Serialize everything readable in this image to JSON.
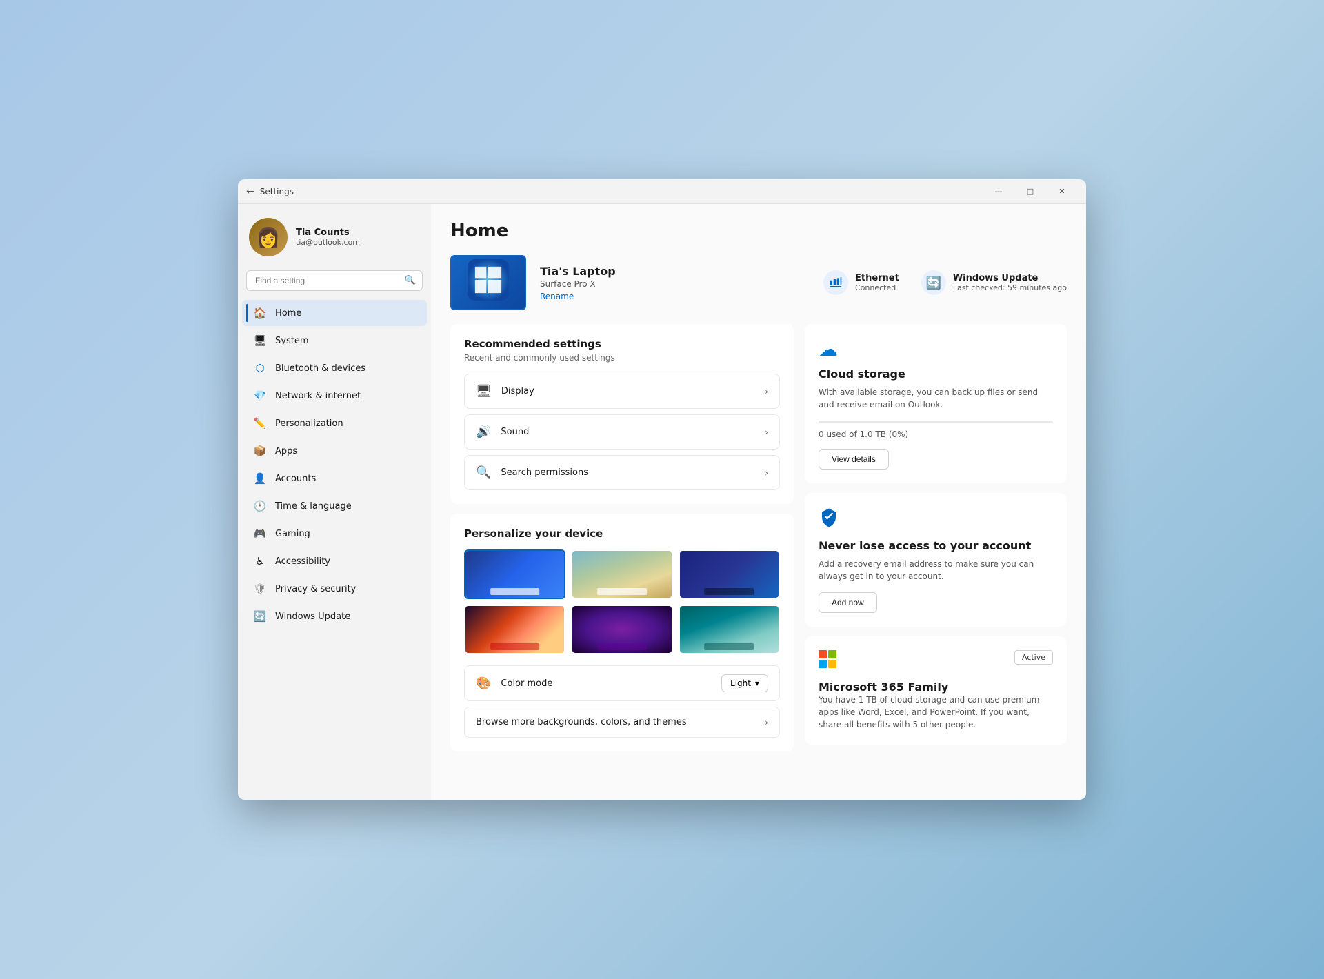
{
  "window": {
    "title": "Settings",
    "back_icon": "←",
    "minimize": "—",
    "maximize": "□",
    "close": "✕"
  },
  "user": {
    "name": "Tia Counts",
    "email": "tia@outlook.com",
    "avatar_emoji": "👩‍🦽"
  },
  "search": {
    "placeholder": "Find a setting"
  },
  "nav": {
    "items": [
      {
        "id": "home",
        "label": "Home",
        "icon": "🏠",
        "active": true
      },
      {
        "id": "system",
        "label": "System",
        "icon": "🖥"
      },
      {
        "id": "bluetooth",
        "label": "Bluetooth & devices",
        "icon": "🔵"
      },
      {
        "id": "network",
        "label": "Network & internet",
        "icon": "💎"
      },
      {
        "id": "personalization",
        "label": "Personalization",
        "icon": "✏️"
      },
      {
        "id": "apps",
        "label": "Apps",
        "icon": "📦"
      },
      {
        "id": "accounts",
        "label": "Accounts",
        "icon": "👤"
      },
      {
        "id": "time-language",
        "label": "Time & language",
        "icon": "🕐"
      },
      {
        "id": "gaming",
        "label": "Gaming",
        "icon": "🎮"
      },
      {
        "id": "accessibility",
        "label": "Accessibility",
        "icon": "♿"
      },
      {
        "id": "privacy",
        "label": "Privacy & security",
        "icon": "🛡"
      },
      {
        "id": "windows-update",
        "label": "Windows Update",
        "icon": "🔄"
      }
    ]
  },
  "page": {
    "title": "Home"
  },
  "device": {
    "name": "Tia's Laptop",
    "model": "Surface Pro X",
    "rename_label": "Rename"
  },
  "stats": {
    "ethernet": {
      "label": "Ethernet",
      "status": "Connected",
      "icon": "🖧"
    },
    "update": {
      "label": "Windows Update",
      "status": "Last checked: 59 minutes ago",
      "icon": "🔄"
    }
  },
  "recommended": {
    "title": "Recommended settings",
    "subtitle": "Recent and commonly used settings",
    "items": [
      {
        "id": "display",
        "label": "Display",
        "icon": "🖥"
      },
      {
        "id": "sound",
        "label": "Sound",
        "icon": "🔊"
      },
      {
        "id": "search-permissions",
        "label": "Search permissions",
        "icon": "🔍"
      }
    ]
  },
  "personalize": {
    "title": "Personalize your device",
    "wallpapers": [
      {
        "id": "w1",
        "class": "w1",
        "selected": true
      },
      {
        "id": "w2",
        "class": "w2",
        "selected": false
      },
      {
        "id": "w3",
        "class": "w3",
        "selected": false
      },
      {
        "id": "w4",
        "class": "w4",
        "selected": false
      },
      {
        "id": "w5",
        "class": "w5",
        "selected": false
      },
      {
        "id": "w6",
        "class": "w6",
        "selected": false
      }
    ],
    "color_mode": {
      "label": "Color mode",
      "icon": "🎨",
      "value": "Light"
    },
    "browse_label": "Browse more backgrounds, colors, and themes"
  },
  "cloud_storage": {
    "icon": "☁",
    "title": "Cloud storage",
    "description": "With available storage, you can back up files or send and receive email on Outlook.",
    "used": "0",
    "total": "1.0 TB (0%)",
    "storage_text": "0 used of 1.0 TB (0%)",
    "fill_percent": 0,
    "button_label": "View details"
  },
  "account_security": {
    "icon": "🛡",
    "title": "Never lose access to your account",
    "description": "Add a recovery email address to make sure you can always get in to your account.",
    "button_label": "Add now"
  },
  "microsoft365": {
    "title": "Microsoft 365 Family",
    "badge": "Active",
    "description": "You have 1 TB of cloud storage and can use premium apps like Word, Excel, and PowerPoint. If you want, share all benefits with 5 other people."
  }
}
